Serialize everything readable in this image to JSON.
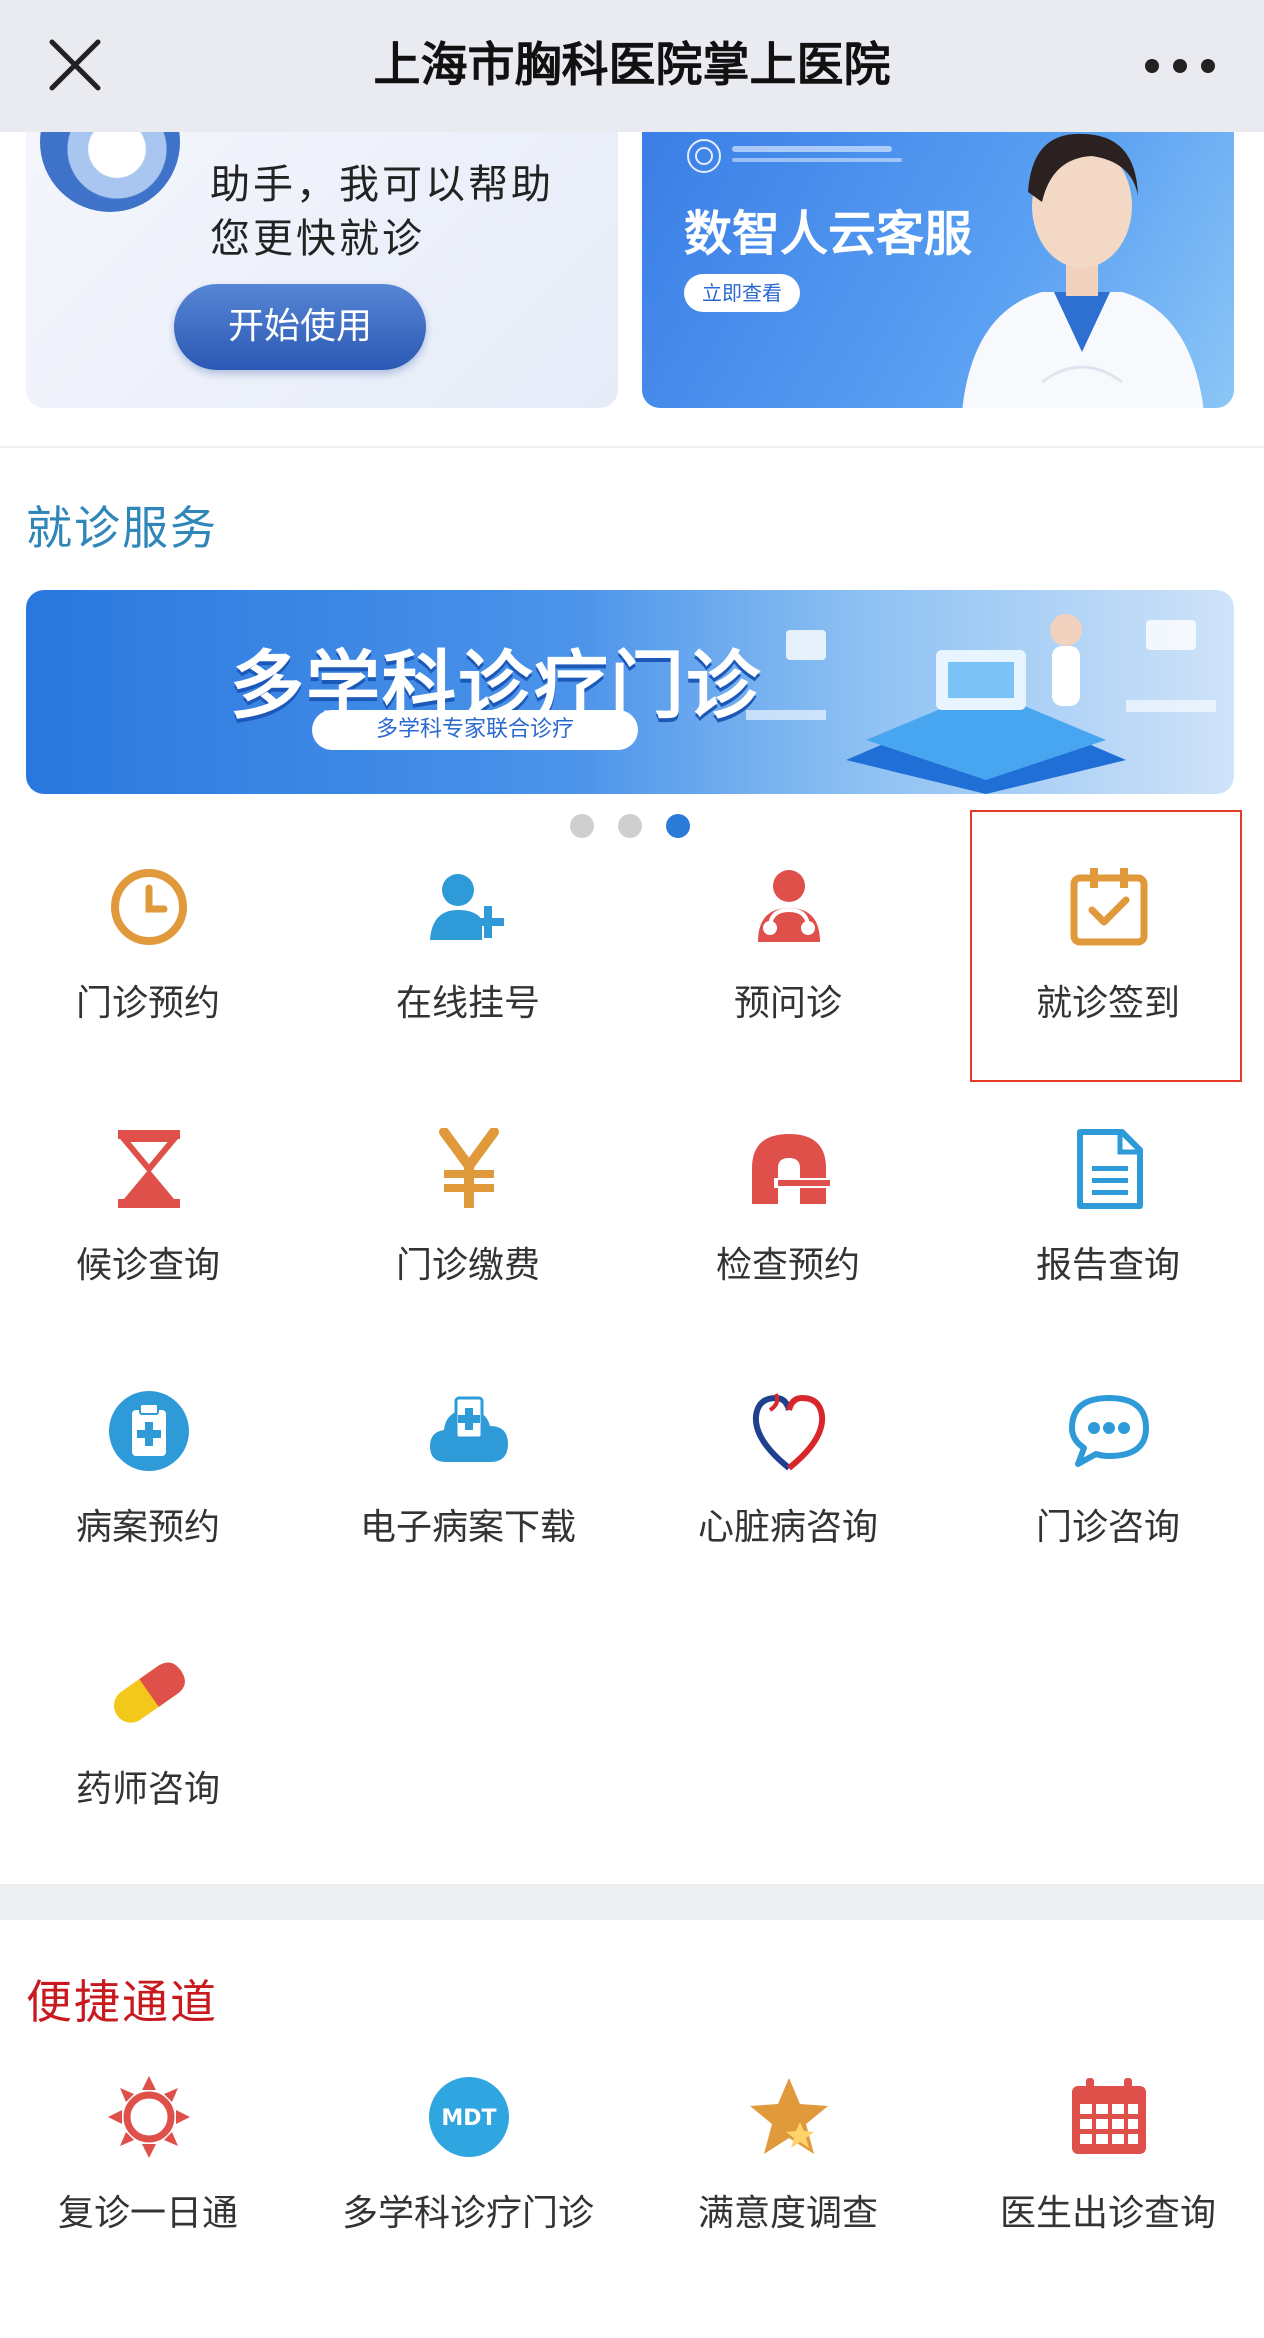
{
  "header": {
    "title": "上海市胸科医院掌上医院"
  },
  "promo": {
    "left": {
      "line1": "助手，我可以帮助",
      "line2": "您更快就诊",
      "button": "开始使用"
    },
    "right": {
      "headline": "数智人云客服",
      "chip": "立即查看"
    }
  },
  "services": {
    "title": "就诊服务",
    "banner": {
      "title": "多学科诊疗门诊",
      "subtitle": "多学科专家联合诊疗"
    },
    "items": [
      {
        "label": "门诊预约",
        "icon": "clock-icon"
      },
      {
        "label": "在线挂号",
        "icon": "add-user-icon"
      },
      {
        "label": "预问诊",
        "icon": "doctor-stethoscope-icon"
      },
      {
        "label": "就诊签到",
        "icon": "calendar-check-icon"
      },
      {
        "label": "候诊查询",
        "icon": "hourglass-icon"
      },
      {
        "label": "门诊缴费",
        "icon": "yen-icon"
      },
      {
        "label": "检查预约",
        "icon": "ct-scanner-icon"
      },
      {
        "label": "报告查询",
        "icon": "document-icon"
      },
      {
        "label": "病案预约",
        "icon": "clipboard-medical-icon"
      },
      {
        "label": "电子病案下载",
        "icon": "cloud-medical-icon"
      },
      {
        "label": "心脏病咨询",
        "icon": "heart-icon"
      },
      {
        "label": "门诊咨询",
        "icon": "chat-bubble-icon"
      },
      {
        "label": "药师咨询",
        "icon": "capsule-icon"
      }
    ]
  },
  "shortcuts": {
    "title": "便捷通道",
    "items": [
      {
        "label": "复诊一日通",
        "icon": "sun-icon"
      },
      {
        "label": "多学科诊疗门诊",
        "icon": "mdt-icon",
        "badge": "MDT"
      },
      {
        "label": "满意度调查",
        "icon": "star-icon"
      },
      {
        "label": "医生出诊查询",
        "icon": "calendar-icon"
      }
    ]
  },
  "colors": {
    "blue_title": "#2f86b8",
    "red_title": "#c8191f",
    "highlight": "#e23b2a",
    "orange": "#e09a3b",
    "red_icon": "#e0504b",
    "blue_icon": "#2f9ad8"
  }
}
